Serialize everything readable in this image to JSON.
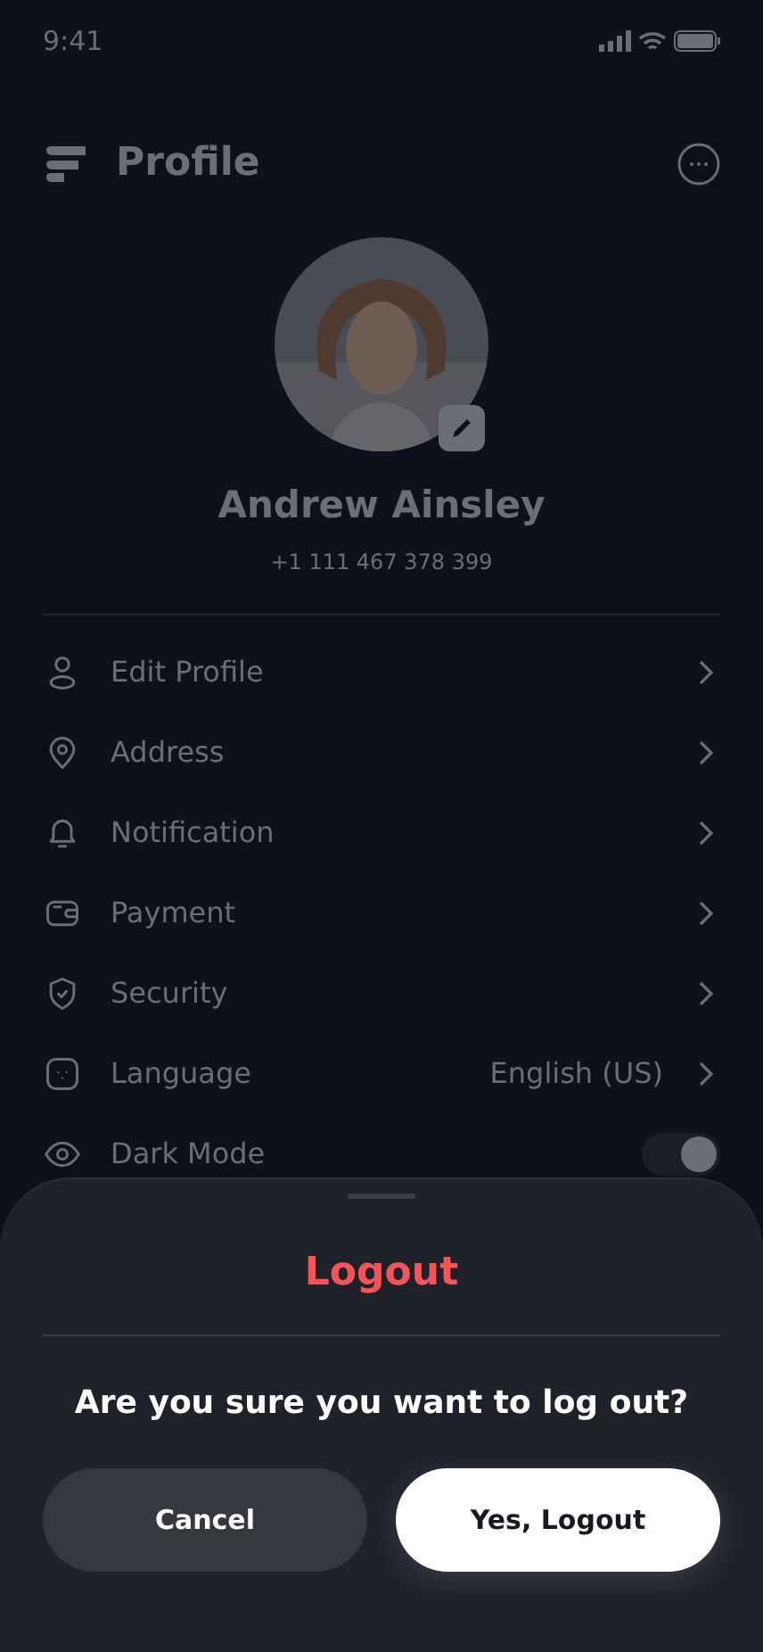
{
  "status_bar": {
    "time": "9:41"
  },
  "header": {
    "title": "Profile"
  },
  "profile": {
    "name": "Andrew Ainsley",
    "phone": "+1 111 467 378 399"
  },
  "menu": [
    {
      "kind": "link",
      "label": "Edit Profile"
    },
    {
      "kind": "link",
      "label": "Address"
    },
    {
      "kind": "link",
      "label": "Notification"
    },
    {
      "kind": "link",
      "label": "Payment"
    },
    {
      "kind": "link",
      "label": "Security"
    },
    {
      "kind": "link",
      "label": "Language",
      "value": "English (US)"
    },
    {
      "kind": "toggle",
      "label": "Dark Mode",
      "on": true
    }
  ],
  "sheet": {
    "title": "Logout",
    "message": "Are you sure you want to log out?",
    "buttons": [
      {
        "kind": "secondary",
        "label": "Cancel"
      },
      {
        "kind": "primary",
        "label": "Yes, Logout"
      }
    ]
  }
}
